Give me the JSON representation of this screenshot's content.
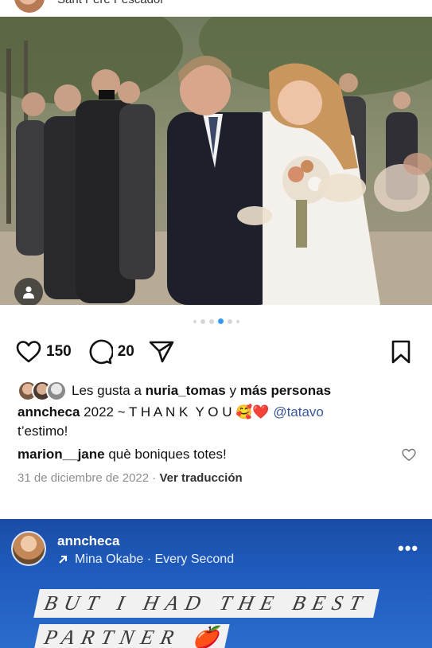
{
  "top": {
    "location": "Sant Pere Pescador"
  },
  "post1": {
    "likes_count": "150",
    "comments_count": "20",
    "likes_prefix": "Les gusta a",
    "liked_by": "nuria_tomas",
    "likes_joiner": "y",
    "likes_others": "más personas",
    "caption": {
      "username": "anncheca",
      "text": "2022 ~ T H A N K  Y O U",
      "emoji": "🥰❤️",
      "mention": "@tatavo",
      "text2": "t’estimo!"
    },
    "comment": {
      "username": "marion__jane",
      "text": "què boniques totes!"
    },
    "date": "31 de diciembre de 2022",
    "separator": "·",
    "translate": "Ver traducción",
    "carousel": {
      "count": 6,
      "active_index": 3
    }
  },
  "post2": {
    "username": "anncheca",
    "audio": "Mina Okabe · Every Second",
    "more": "•••",
    "banner1": "BUT I HAD THE BEST",
    "banner2": "PARTNER",
    "banner2_emoji": "🍎"
  },
  "icons": {
    "like": "heart-icon",
    "comment": "comment-icon",
    "share": "send-icon",
    "save": "bookmark-icon",
    "user_tag": "user-icon",
    "audio": "arrow-icon"
  },
  "colors": {
    "link": "#385898",
    "carousel_active": "#3897f0",
    "post2_bg": "#1f5bbd"
  }
}
